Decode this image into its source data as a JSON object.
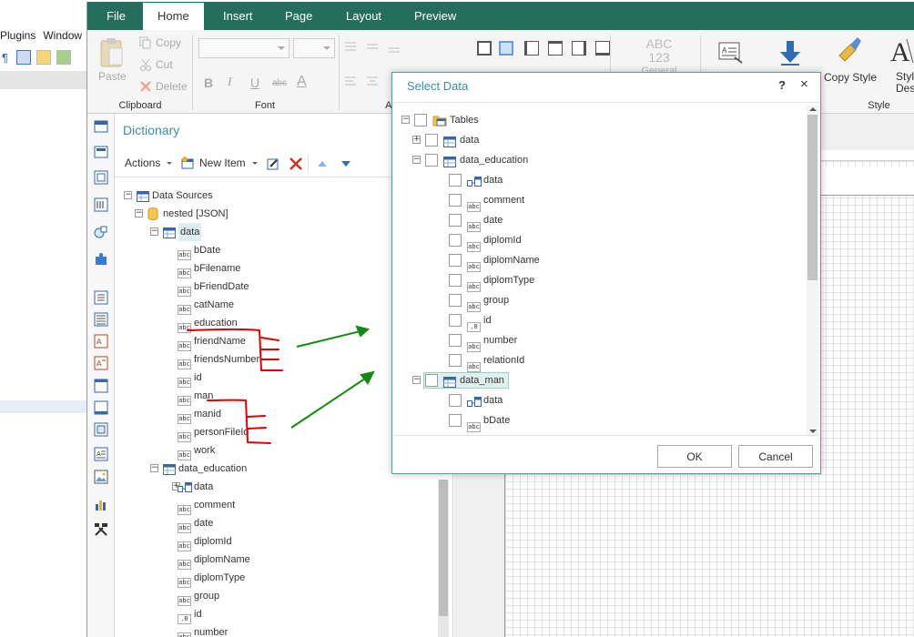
{
  "background_app": {
    "menu": [
      "Plugins",
      "Window"
    ]
  },
  "tabs": [
    {
      "label": "File",
      "active": false
    },
    {
      "label": "Home",
      "active": true
    },
    {
      "label": "Insert",
      "active": false
    },
    {
      "label": "Page",
      "active": false
    },
    {
      "label": "Layout",
      "active": false
    },
    {
      "label": "Preview",
      "active": false
    }
  ],
  "ribbon": {
    "clipboard": {
      "label": "Clipboard",
      "paste": "Paste",
      "copy": "Copy",
      "cut": "Cut",
      "delete": "Delete"
    },
    "font": {
      "label": "Font"
    },
    "alignment": {
      "label": "Al"
    },
    "text_format": {
      "sample_top": "ABC",
      "sample_mid": "123",
      "sample_bottom": "General"
    },
    "copy_style": "Copy Style",
    "style": {
      "label": "Style",
      "button_top": "Styl",
      "button_bottom": "Desig"
    }
  },
  "dictionary": {
    "title": "Dictionary",
    "toolbar": {
      "actions": "Actions",
      "new_item": "New Item"
    },
    "tree": [
      {
        "label": "Data Sources",
        "level": 0,
        "icon": "table",
        "expander": "−"
      },
      {
        "label": "nested [JSON]",
        "level": 1,
        "icon": "database",
        "expander": "−"
      },
      {
        "label": "data",
        "level": 2,
        "icon": "table",
        "expander": "−",
        "highlight": true
      },
      {
        "label": "bDate",
        "level": 3,
        "icon": "abc"
      },
      {
        "label": "bFilename",
        "level": 3,
        "icon": "abc"
      },
      {
        "label": "bFriendDate",
        "level": 3,
        "icon": "abc"
      },
      {
        "label": "catName",
        "level": 3,
        "icon": "abc"
      },
      {
        "label": "education",
        "level": 3,
        "icon": "abc"
      },
      {
        "label": "friendName",
        "level": 3,
        "icon": "abc"
      },
      {
        "label": "friendsNumber",
        "level": 3,
        "icon": "abc"
      },
      {
        "label": "id",
        "level": 3,
        "icon": "abc"
      },
      {
        "label": "man",
        "level": 3,
        "icon": "abc"
      },
      {
        "label": "manid",
        "level": 3,
        "icon": "abc"
      },
      {
        "label": "personFileId",
        "level": 3,
        "icon": "abc"
      },
      {
        "label": "work",
        "level": 3,
        "icon": "abc"
      },
      {
        "label": "data_education",
        "level": 2,
        "icon": "table",
        "expander": "−"
      },
      {
        "label": "data",
        "level": 3,
        "icon": "relation",
        "expander": "+"
      },
      {
        "label": "comment",
        "level": 3,
        "icon": "abc"
      },
      {
        "label": "date",
        "level": 3,
        "icon": "abc"
      },
      {
        "label": "diplomId",
        "level": 3,
        "icon": "abc"
      },
      {
        "label": "diplomName",
        "level": 3,
        "icon": "abc"
      },
      {
        "label": "diplomType",
        "level": 3,
        "icon": "abc"
      },
      {
        "label": "group",
        "level": 3,
        "icon": "abc"
      },
      {
        "label": "id",
        "level": 3,
        "icon": "num"
      },
      {
        "label": "number",
        "level": 3,
        "icon": "abc"
      }
    ]
  },
  "dialog": {
    "title": "Select Data",
    "help": "?",
    "close": "×",
    "ok": "OK",
    "cancel": "Cancel",
    "tree": [
      {
        "label": "Tables",
        "level": 0,
        "icon": "folder",
        "expander": "−",
        "checkbox": true
      },
      {
        "label": "data",
        "level": 1,
        "icon": "table",
        "expander": "+",
        "checkbox": true
      },
      {
        "label": "data_education",
        "level": 1,
        "icon": "table",
        "expander": "−",
        "checkbox": true
      },
      {
        "label": "data",
        "level": 2,
        "icon": "relation",
        "checkbox": true
      },
      {
        "label": "comment",
        "level": 2,
        "icon": "abc",
        "checkbox": true
      },
      {
        "label": "date",
        "level": 2,
        "icon": "abc",
        "checkbox": true
      },
      {
        "label": "diplomId",
        "level": 2,
        "icon": "abc",
        "checkbox": true
      },
      {
        "label": "diplomName",
        "level": 2,
        "icon": "abc",
        "checkbox": true
      },
      {
        "label": "diplomType",
        "level": 2,
        "icon": "abc",
        "checkbox": true
      },
      {
        "label": "group",
        "level": 2,
        "icon": "abc",
        "checkbox": true
      },
      {
        "label": "id",
        "level": 2,
        "icon": "num",
        "checkbox": true
      },
      {
        "label": "number",
        "level": 2,
        "icon": "abc",
        "checkbox": true
      },
      {
        "label": "relationId",
        "level": 2,
        "icon": "abc",
        "checkbox": true
      },
      {
        "label": "data_man",
        "level": 1,
        "icon": "table",
        "expander": "−",
        "checkbox": true,
        "selected": true
      },
      {
        "label": "data",
        "level": 2,
        "icon": "relation",
        "checkbox": true
      },
      {
        "label": "bDate",
        "level": 2,
        "icon": "abc",
        "checkbox": true
      }
    ]
  },
  "icon_labels": {
    "abc": "abc",
    "num": ".0"
  },
  "colors": {
    "tabbar": "#256e5d",
    "accent": "#3f8c9c",
    "annotation_red": "#e00000",
    "annotation_green": "#138a13"
  }
}
